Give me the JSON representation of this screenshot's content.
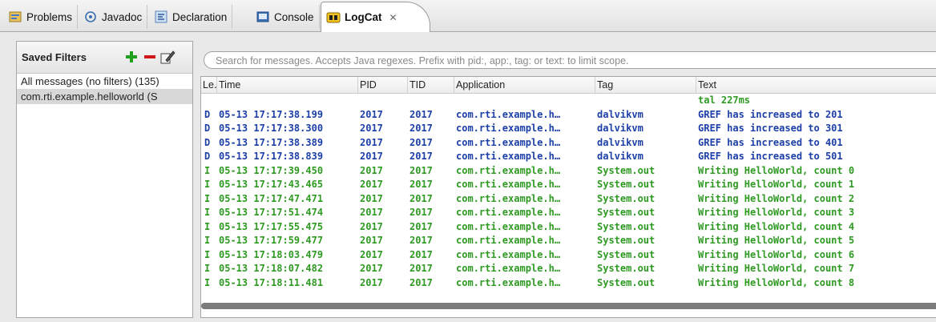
{
  "tabs": [
    {
      "label": "Problems",
      "icon": "problems-icon"
    },
    {
      "label": "Javadoc",
      "icon": "javadoc-icon"
    },
    {
      "label": "Declaration",
      "icon": "declaration-icon"
    },
    {
      "label": "Console",
      "icon": "console-icon"
    },
    {
      "label": "LogCat",
      "icon": "logcat-icon",
      "close": "✕"
    }
  ],
  "filters": {
    "title": "Saved Filters",
    "items": [
      "All messages (no filters) (135)",
      "com.rti.example.helloworld (S"
    ],
    "add_color": "#1fa01f",
    "remove_color": "#d01818"
  },
  "search": {
    "placeholder": "Search for messages. Accepts Java regexes. Prefix with pid:, app:, tag: or text: to limit scope."
  },
  "columns": {
    "level": "Le․",
    "time": "Time",
    "pid": "PID",
    "tid": "TID",
    "app": "Application",
    "tag": "Tag",
    "text": "Text"
  },
  "rows": [
    {
      "level": "",
      "time": "",
      "pid": "",
      "tid": "",
      "app": "",
      "tag": "",
      "text": "tal 227ms",
      "cls": "lvl-I"
    },
    {
      "level": "D",
      "time": "05-13 17:17:38.199",
      "pid": "2017",
      "tid": "2017",
      "app": "com.rti.example.h…",
      "tag": "dalvikvm",
      "text": "GREF has increased to 201",
      "cls": "lvl-D"
    },
    {
      "level": "D",
      "time": "05-13 17:17:38.300",
      "pid": "2017",
      "tid": "2017",
      "app": "com.rti.example.h…",
      "tag": "dalvikvm",
      "text": "GREF has increased to 301",
      "cls": "lvl-D"
    },
    {
      "level": "D",
      "time": "05-13 17:17:38.389",
      "pid": "2017",
      "tid": "2017",
      "app": "com.rti.example.h…",
      "tag": "dalvikvm",
      "text": "GREF has increased to 401",
      "cls": "lvl-D"
    },
    {
      "level": "D",
      "time": "05-13 17:17:38.839",
      "pid": "2017",
      "tid": "2017",
      "app": "com.rti.example.h…",
      "tag": "dalvikvm",
      "text": "GREF has increased to 501",
      "cls": "lvl-D"
    },
    {
      "level": "I",
      "time": "05-13 17:17:39.450",
      "pid": "2017",
      "tid": "2017",
      "app": "com.rti.example.h…",
      "tag": "System.out",
      "text": "Writing HelloWorld, count 0",
      "cls": "lvl-I"
    },
    {
      "level": "I",
      "time": "05-13 17:17:43.465",
      "pid": "2017",
      "tid": "2017",
      "app": "com.rti.example.h…",
      "tag": "System.out",
      "text": "Writing HelloWorld, count 1",
      "cls": "lvl-I"
    },
    {
      "level": "I",
      "time": "05-13 17:17:47.471",
      "pid": "2017",
      "tid": "2017",
      "app": "com.rti.example.h…",
      "tag": "System.out",
      "text": "Writing HelloWorld, count 2",
      "cls": "lvl-I"
    },
    {
      "level": "I",
      "time": "05-13 17:17:51.474",
      "pid": "2017",
      "tid": "2017",
      "app": "com.rti.example.h…",
      "tag": "System.out",
      "text": "Writing HelloWorld, count 3",
      "cls": "lvl-I"
    },
    {
      "level": "I",
      "time": "05-13 17:17:55.475",
      "pid": "2017",
      "tid": "2017",
      "app": "com.rti.example.h…",
      "tag": "System.out",
      "text": "Writing HelloWorld, count 4",
      "cls": "lvl-I"
    },
    {
      "level": "I",
      "time": "05-13 17:17:59.477",
      "pid": "2017",
      "tid": "2017",
      "app": "com.rti.example.h…",
      "tag": "System.out",
      "text": "Writing HelloWorld, count 5",
      "cls": "lvl-I"
    },
    {
      "level": "I",
      "time": "05-13 17:18:03.479",
      "pid": "2017",
      "tid": "2017",
      "app": "com.rti.example.h…",
      "tag": "System.out",
      "text": "Writing HelloWorld, count 6",
      "cls": "lvl-I"
    },
    {
      "level": "I",
      "time": "05-13 17:18:07.482",
      "pid": "2017",
      "tid": "2017",
      "app": "com.rti.example.h…",
      "tag": "System.out",
      "text": "Writing HelloWorld, count 7",
      "cls": "lvl-I"
    },
    {
      "level": "I",
      "time": "05-13 17:18:11.481",
      "pid": "2017",
      "tid": "2017",
      "app": "com.rti.example.h…",
      "tag": "System.out",
      "text": "Writing HelloWorld, count 8",
      "cls": "lvl-I"
    }
  ],
  "colors": {
    "debug": "#1c3fa8",
    "info": "#2e9a22"
  }
}
